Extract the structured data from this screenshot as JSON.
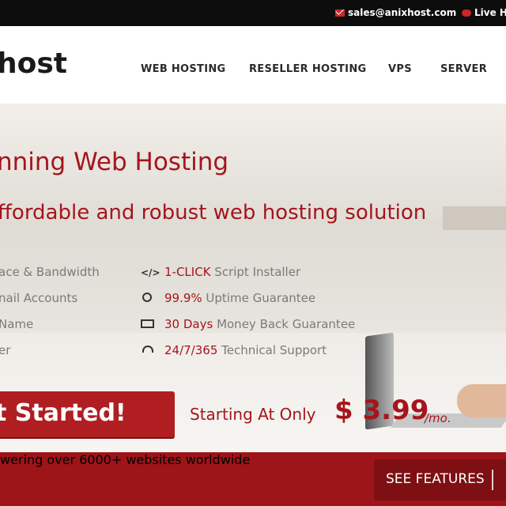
{
  "topbar": {
    "email_icon": "envelope-icon",
    "email": "sales@anixhost.com",
    "chat_icon": "chat-bubble-icon",
    "live_help": "Live H"
  },
  "header": {
    "logo_text": "host",
    "nav": [
      "WEB HOSTING",
      "RESELLER HOSTING",
      "VPS",
      "SERVER"
    ]
  },
  "hero": {
    "headline": "nning Web Hosting",
    "subheadline": "ffordable and robust web hosting solution",
    "features_left": [
      "ace & Bandwidth",
      "nail Accounts",
      "Name",
      "er"
    ],
    "features_right": [
      {
        "icon": "code-icon",
        "highlight": "1-CLICK",
        "text": " Script Installer"
      },
      {
        "icon": "clock-icon",
        "highlight": "99.9%",
        "text": " Uptime Guarantee"
      },
      {
        "icon": "money-icon",
        "highlight": "30 Days",
        "text": " Money Back Guarantee"
      },
      {
        "icon": "headset-icon",
        "highlight": "24/7/365",
        "text": " Technical Support"
      }
    ],
    "cta_label": "t Started!",
    "price_label": "Starting At Only",
    "price": "$ 3.99",
    "per": "/mo."
  },
  "band": {
    "text": "wering over 6000+ websites worldwide",
    "see_features": "SEE FEATURES"
  },
  "colors": {
    "brand_red": "#a5151c",
    "band_red": "#9d1419",
    "topbar": "#0d0d0d"
  }
}
